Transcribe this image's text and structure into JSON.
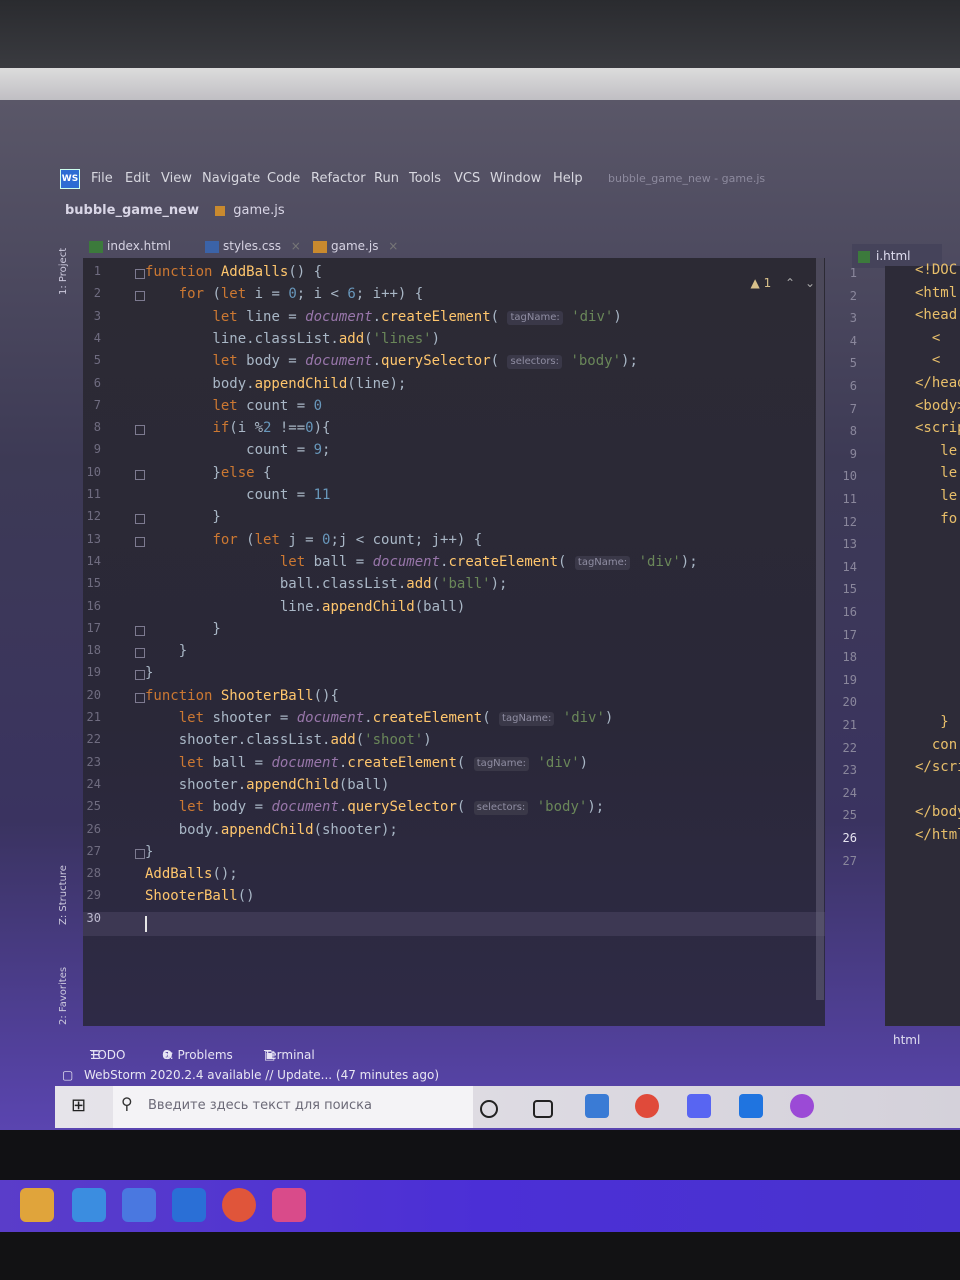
{
  "menubar": {
    "logo": "WS",
    "items": [
      "File",
      "Edit",
      "View",
      "Navigate",
      "Code",
      "Refactor",
      "Run",
      "Tools",
      "VCS",
      "Window",
      "Help"
    ],
    "project_title": "bubble_game_new - game.js"
  },
  "breadcrumb": {
    "project": "bubble_game_new",
    "file": "game.js"
  },
  "tabs": [
    {
      "label": "index.html",
      "icon": "html-file-icon"
    },
    {
      "label": "styles.css",
      "icon": "css-file-icon"
    },
    {
      "label": "game.js",
      "icon": "js-file-icon",
      "active": true
    }
  ],
  "sidebar": {
    "project": "1: Project",
    "structure": "Z: Structure",
    "favorites": "2: Favorites"
  },
  "inspection": {
    "warnings": "1"
  },
  "code_lines": [
    {
      "n": "1",
      "html": "<span class=\"kw\">function</span> <span class=\"fn\">AddBalls</span>() {"
    },
    {
      "n": "2",
      "html": "    <span class=\"kw\">for</span> (<span class=\"kw\">let</span> i = <span class=\"num\">0</span>; i &lt; <span class=\"num\">6</span>; i++) {"
    },
    {
      "n": "3",
      "html": "        <span class=\"kw\">let</span> line = <span class=\"doc\">document</span>.<span class=\"fn\">createElement</span>( <span class=\"hint\">tagName:</span> <span class=\"str\">'div'</span>)"
    },
    {
      "n": "4",
      "html": "        line.classList.<span class=\"fn\">add</span>(<span class=\"str\">'lines'</span>)"
    },
    {
      "n": "5",
      "html": "        <span class=\"kw\">let</span> body = <span class=\"doc\">document</span>.<span class=\"fn\">querySelector</span>( <span class=\"hint\">selectors:</span> <span class=\"str\">'body'</span>);"
    },
    {
      "n": "6",
      "html": "        body.<span class=\"fn\">appendChild</span>(line);"
    },
    {
      "n": "7",
      "html": "        <span class=\"kw\">let</span> count = <span class=\"num\">0</span>"
    },
    {
      "n": "8",
      "html": "        <span class=\"kw\">if</span>(i %<span class=\"num\">2</span> !==<span class=\"num\">0</span>){"
    },
    {
      "n": "9",
      "html": "            count = <span class=\"num\">9</span>;"
    },
    {
      "n": "10",
      "html": "        }<span class=\"kw\">else</span> {"
    },
    {
      "n": "11",
      "html": "            count = <span class=\"num\">11</span>"
    },
    {
      "n": "12",
      "html": "        }"
    },
    {
      "n": "13",
      "html": "        <span class=\"kw\">for</span> (<span class=\"kw\">let</span> j = <span class=\"num\">0</span>;j &lt; count; j++) {"
    },
    {
      "n": "14",
      "html": "                <span class=\"kw\">let</span> ball = <span class=\"doc\">document</span>.<span class=\"fn\">createElement</span>( <span class=\"hint\">tagName:</span> <span class=\"str\">'div'</span>);"
    },
    {
      "n": "15",
      "html": "                ball.classList.<span class=\"fn\">add</span>(<span class=\"str\">'ball'</span>);"
    },
    {
      "n": "16",
      "html": "                line.<span class=\"fn\">appendChild</span>(ball)"
    },
    {
      "n": "17",
      "html": "        }"
    },
    {
      "n": "18",
      "html": "    }"
    },
    {
      "n": "19",
      "html": "}"
    },
    {
      "n": "20",
      "html": "<span class=\"kw\">function</span> <span class=\"fn\">ShooterBall</span>(){"
    },
    {
      "n": "21",
      "html": "    <span class=\"kw\">let</span> shooter = <span class=\"doc\">document</span>.<span class=\"fn\">createElement</span>( <span class=\"hint\">tagName:</span> <span class=\"str\">'div'</span>)"
    },
    {
      "n": "22",
      "html": "    shooter.classList.<span class=\"fn\">add</span>(<span class=\"str\">'shoot'</span>)"
    },
    {
      "n": "23",
      "html": "    <span class=\"kw\">let</span> ball = <span class=\"doc\">document</span>.<span class=\"fn\">createElement</span>( <span class=\"hint\">tagName:</span> <span class=\"str\">'div'</span>)"
    },
    {
      "n": "24",
      "html": "    shooter.<span class=\"fn\">appendChild</span>(ball)"
    },
    {
      "n": "25",
      "html": "    <span class=\"kw\">let</span> body = <span class=\"doc\">document</span>.<span class=\"fn\">querySelector</span>( <span class=\"hint\">selectors:</span> <span class=\"str\">'body'</span>);"
    },
    {
      "n": "26",
      "html": "    body.<span class=\"fn\">appendChild</span>(shooter);"
    },
    {
      "n": "27",
      "html": "}"
    },
    {
      "n": "28",
      "html": "<span class=\"fn\">AddBalls</span>();"
    },
    {
      "n": "29",
      "html": "<span class=\"fn\">ShooterBall</span>()"
    },
    {
      "n": "30",
      "html": ""
    }
  ],
  "right_pane": {
    "tab": "i.html",
    "footer": "html",
    "lines": [
      "<!DOC",
      "<html",
      "<head",
      "  <",
      "  <",
      "</head",
      "<body>",
      "<scrip",
      "   le",
      "   le",
      "   le",
      "   fo",
      "",
      "",
      "",
      "",
      "",
      "",
      "",
      "",
      "   }",
      "  con",
      "</scrip",
      "",
      "</body>",
      "</html>",
      ""
    ]
  },
  "tool_windows": [
    "TODO",
    "6: Problems",
    "Terminal"
  ],
  "status": "WebStorm 2020.2.4 available // Update... (47 minutes ago)",
  "taskbar": {
    "search_placeholder": "Введите здесь текст для поиска"
  }
}
